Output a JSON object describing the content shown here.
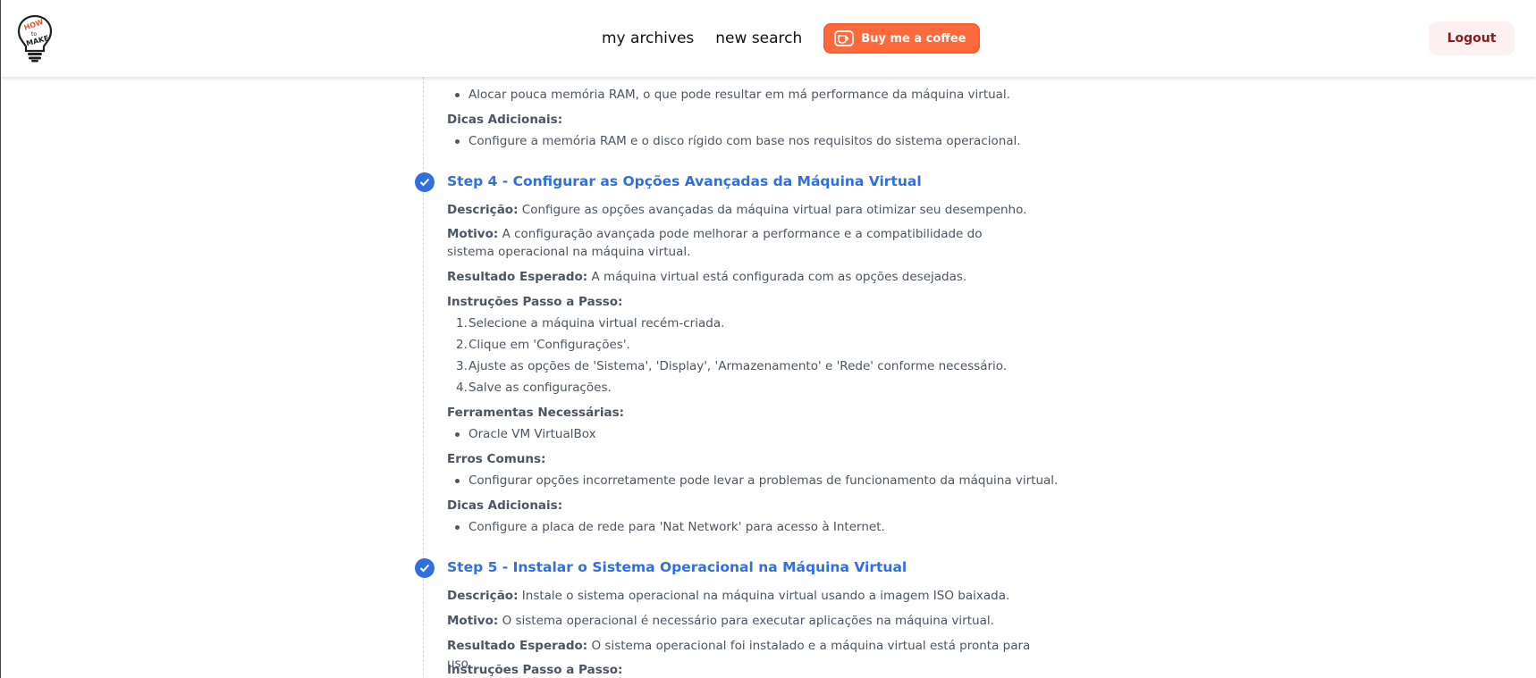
{
  "header": {
    "nav": {
      "archives": "my archives",
      "new_search": "new search",
      "coffee": "Buy me a coffee"
    },
    "logout": "Logout"
  },
  "step3_tail": {
    "error_item": "Alocar pouca memória RAM, o que pode resultar em má performance da máquina virtual.",
    "tips_title": "Dicas Adicionais:",
    "tips_item": "Configure a memória RAM e o disco rígido com base nos requisitos do sistema operacional."
  },
  "step4": {
    "title": "Step 4 - Configurar as Opções Avançadas da Máquina Virtual",
    "desc_label": "Descrição:",
    "desc": "Configure as opções avançadas da máquina virtual para otimizar seu desempenho.",
    "motive_label": "Motivo:",
    "motive": "A configuração avançada pode melhorar a performance e a compatibilidade do sistema operacional na máquina virtual.",
    "result_label": "Resultado Esperado:",
    "result": "A máquina virtual está configurada com as opções desejadas.",
    "instructions_title": "Instruções Passo a Passo:",
    "instructions": [
      "Selecione a máquina virtual recém-criada.",
      "Clique em 'Configurações'.",
      "Ajuste as opções de 'Sistema', 'Display', 'Armazenamento' e 'Rede' conforme necessário.",
      "Salve as configurações."
    ],
    "tools_title": "Ferramentas Necessárias:",
    "tools": [
      "Oracle VM VirtualBox"
    ],
    "errors_title": "Erros Comuns:",
    "errors": [
      "Configurar opções incorretamente pode levar a problemas de funcionamento da máquina virtual."
    ],
    "tips_title": "Dicas Adicionais:",
    "tips": [
      "Configure a placa de rede para 'Nat Network' para acesso à Internet."
    ]
  },
  "step5": {
    "title": "Step 5 - Instalar o Sistema Operacional na Máquina Virtual",
    "desc_label": "Descrição:",
    "desc": "Instale o sistema operacional na máquina virtual usando a imagem ISO baixada.",
    "motive_label": "Motivo:",
    "motive": "O sistema operacional é necessário para executar aplicações na máquina virtual.",
    "result_label": "Resultado Esperado:",
    "result": "O sistema operacional foi instalado e a máquina virtual está pronta para uso.",
    "instructions_title": "Instruções Passo a Passo:"
  },
  "nums": [
    "1.",
    "2.",
    "3.",
    "4."
  ],
  "colors": {
    "accent_blue": "#2f6fe0",
    "tips_green": "#22b14c",
    "errors_red": "#e03a3a",
    "coffee_orange": "#ff6a3d",
    "logout_bg": "#fdf0f0"
  }
}
